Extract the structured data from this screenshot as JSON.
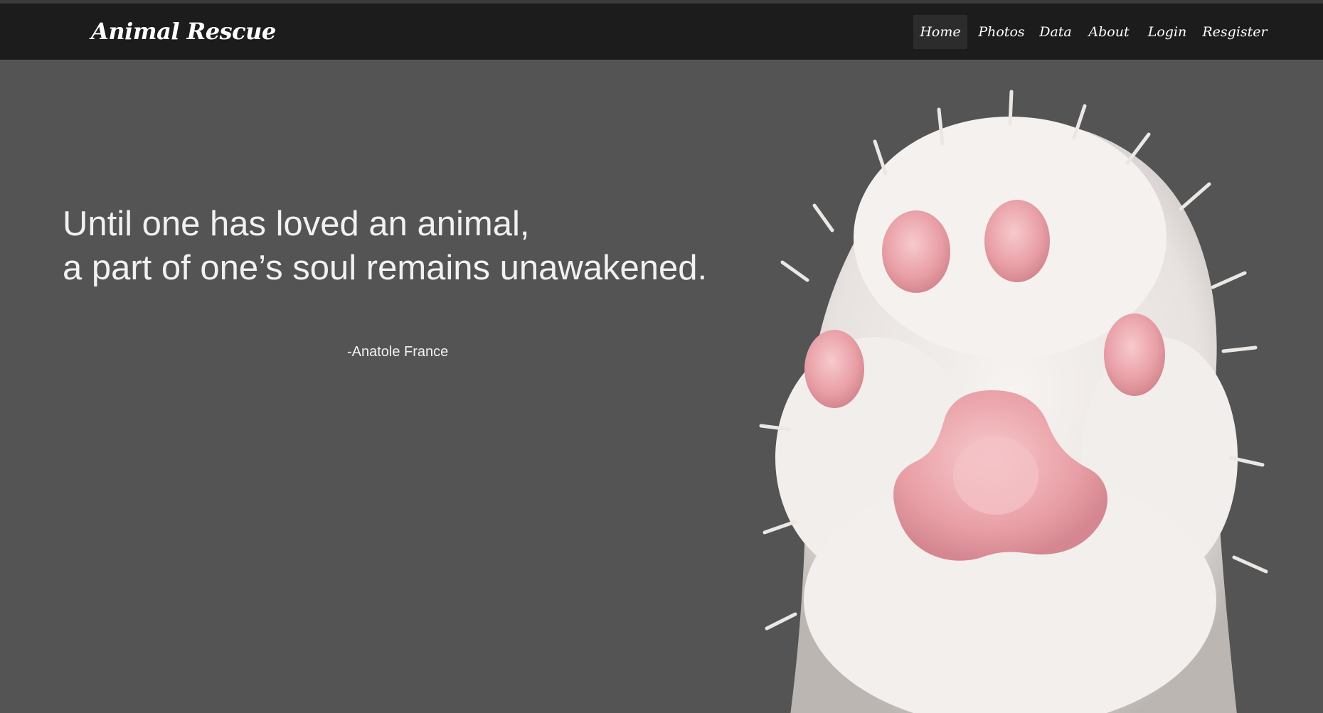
{
  "brand": "Animal Rescue",
  "nav": {
    "home": "Home",
    "photos": "Photos",
    "data": "Data",
    "about": "About",
    "login": "Login",
    "register": "Resgister"
  },
  "hero": {
    "quote_line1": "Until one has loved an animal,",
    "quote_line2": "a part of one’s soul remains unawakened.",
    "author": "-Anatole France"
  },
  "colors": {
    "navbar": "#1c1c1c",
    "background": "#545454",
    "text": "#f1f1f1",
    "active_nav": "#2c2c2c",
    "paw_pink": "#f2b8bd"
  },
  "icons": {
    "hero_image": "cat-paw-photo"
  }
}
